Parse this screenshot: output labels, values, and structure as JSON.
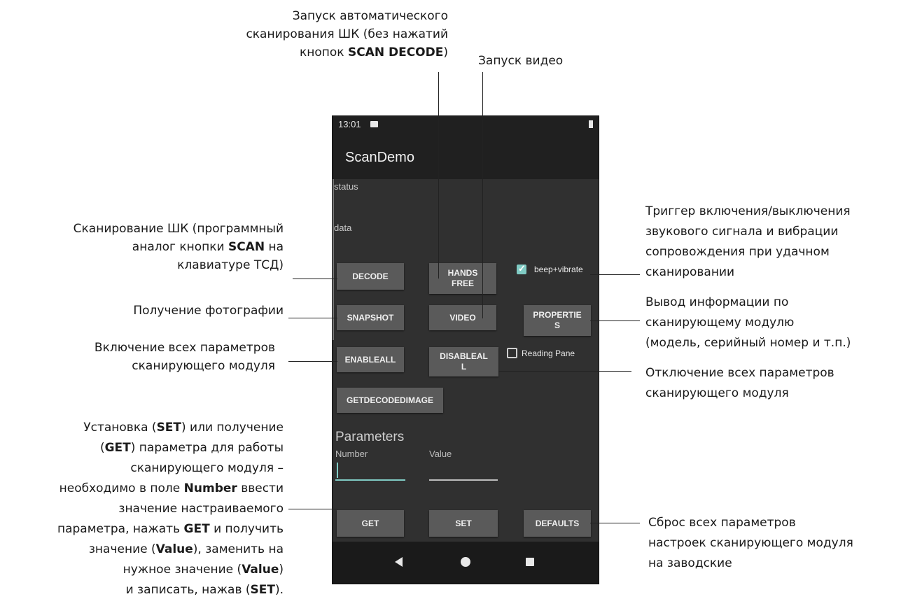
{
  "phone": {
    "status_bar": {
      "time": "13:01"
    },
    "app_title": "ScanDemo",
    "labels": {
      "status": "status",
      "data": "data"
    },
    "buttons": {
      "decode": "DECODE",
      "hands_free": "HANDS FREE",
      "snapshot": "SNAPSHOT",
      "video": "VIDEO",
      "properties": "PROPERTIE S",
      "enableall": "ENABLEALL",
      "disableall": "DISABLEAL L",
      "getdecodedimage": "GETDECODEDIMAGE",
      "get": "GET",
      "set": "SET",
      "defaults": "DEFAULTS"
    },
    "checkboxes": {
      "beep_vibrate": {
        "label": "beep+vibrate",
        "checked": true
      },
      "reading_pane": {
        "label": "Reading Pane",
        "checked": false
      }
    },
    "parameters": {
      "title": "Parameters",
      "number_label": "Number",
      "value_label": "Value",
      "number_value": "",
      "value_value": ""
    },
    "accent_color": "#80cbc4",
    "icons": [
      "image-icon",
      "battery-icon",
      "back-icon",
      "home-icon",
      "recents-icon"
    ]
  },
  "annotations": {
    "auto_scan": {
      "line1": "Запуск автоматического",
      "line2": "сканирования ШК (без нажатий",
      "line3_pre": "кнопок ",
      "line3_bold": "SCAN DECODE",
      "line3_post": ")"
    },
    "video": "Запуск видео",
    "decode": {
      "line1": "Сканирование ШК (программный",
      "line2_pre": "аналог кнопки ",
      "line2_bold": "SCAN",
      "line2_post": " на",
      "line3": "клавиатуре ТСД)"
    },
    "snapshot": "Получение фотографии",
    "enableall": {
      "line1": "Включение всех параметров",
      "line2": "сканирующего модуля"
    },
    "parameters": {
      "line1_pre": "Установка (",
      "line1_bold": "SET",
      "line1_post": ") или получение",
      "line2_pre": "(",
      "line2_bold": "GET",
      "line2_post": ") параметра для работы",
      "line3": "сканирующего модуля –",
      "line4_pre": "необходимо в поле ",
      "line4_bold": "Number",
      "line4_post": " ввести",
      "line5": "значение настраиваемого",
      "line6_pre": "параметра, нажать ",
      "line6_bold": "GET",
      "line6_post": " и получить",
      "line7_pre": "значение (",
      "line7_bold": "Value",
      "line7_post": "), заменить на",
      "line8_pre": "нужное значение (",
      "line8_bold": "Value",
      "line8_post": ")",
      "line9_pre": "и записать, нажав (",
      "line9_bold": "SET",
      "line9_post": ")."
    },
    "beep": {
      "line1": "Триггер включения/выключения",
      "line2": "звукового сигнала и вибрации",
      "line3": "сопровождения при удачном",
      "line4": "сканировании"
    },
    "properties": {
      "line1": "Вывод информации по",
      "line2": "сканирующему модулю",
      "line3": "(модель, серийный номер и т.п.)"
    },
    "disableall": {
      "line1": "Отключение всех параметров",
      "line2": "сканирующего модуля"
    },
    "defaults": {
      "line1": "Сброс всех параметров",
      "line2": "настроек сканирующего модуля",
      "line3": "на заводские"
    }
  }
}
